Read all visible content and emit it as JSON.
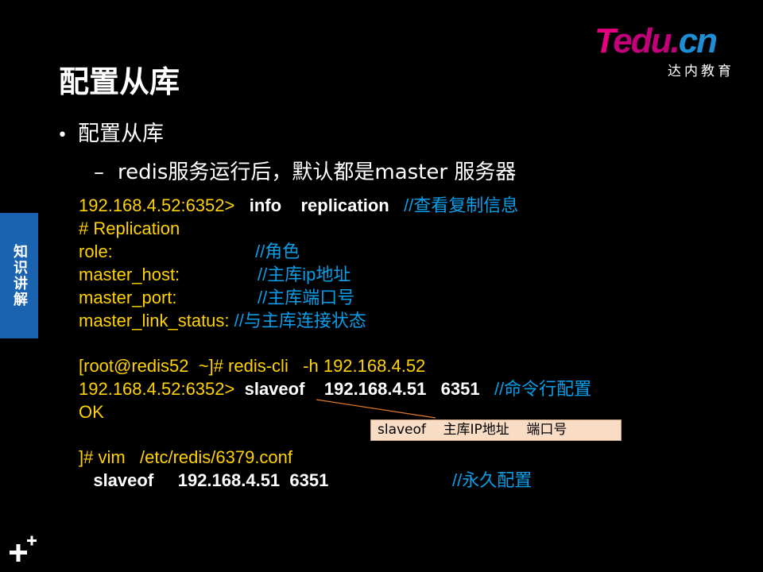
{
  "logo": {
    "brand_t": "T",
    "brand_edu": "edu.",
    "brand_cn": "cn",
    "subtitle": "达内教育"
  },
  "title": "配置从库",
  "side_tab": "知识讲解",
  "bullet1": "配置从库",
  "bullet2": "redis服务运行后，默认都是master  服务器",
  "code": {
    "l1_prompt": "192.168.4.52:6352>  ",
    "l1_cmd": " info    replication ",
    "l1_comment": "  //查看复制信息",
    "l2": "# Replication",
    "l3_key": "role:",
    "l3_comment": "//角色",
    "l4_key": "master_host:",
    "l4_comment": "//主库ip地址",
    "l5_key": "master_port:",
    "l5_comment": "//主库端口号",
    "l6_key": "master_link_status: ",
    "l6_comment": "//与主库连接状态",
    "l7": "[root@redis52  ~]# redis-cli   -h 192.168.4.52",
    "l8_prompt": "192.168.4.52:6352>  ",
    "l8_cmd": "slaveof    192.168.4.51   6351  ",
    "l8_comment": " //命令行配置",
    "l9": "OK",
    "l10": "]# vim   /etc/redis/6379.conf",
    "l11_cmd": "   slaveof     192.168.4.51  6351",
    "l11_comment": "//永久配置"
  },
  "callout": "slaveof    主库IP地址    端口号",
  "colors": {
    "background": "#000000",
    "code_yellow": "#ffd200",
    "comment_blue": "#0a9de8",
    "side_tab_blue": "#1a63b0",
    "callout_fill": "#f9dcc4"
  }
}
